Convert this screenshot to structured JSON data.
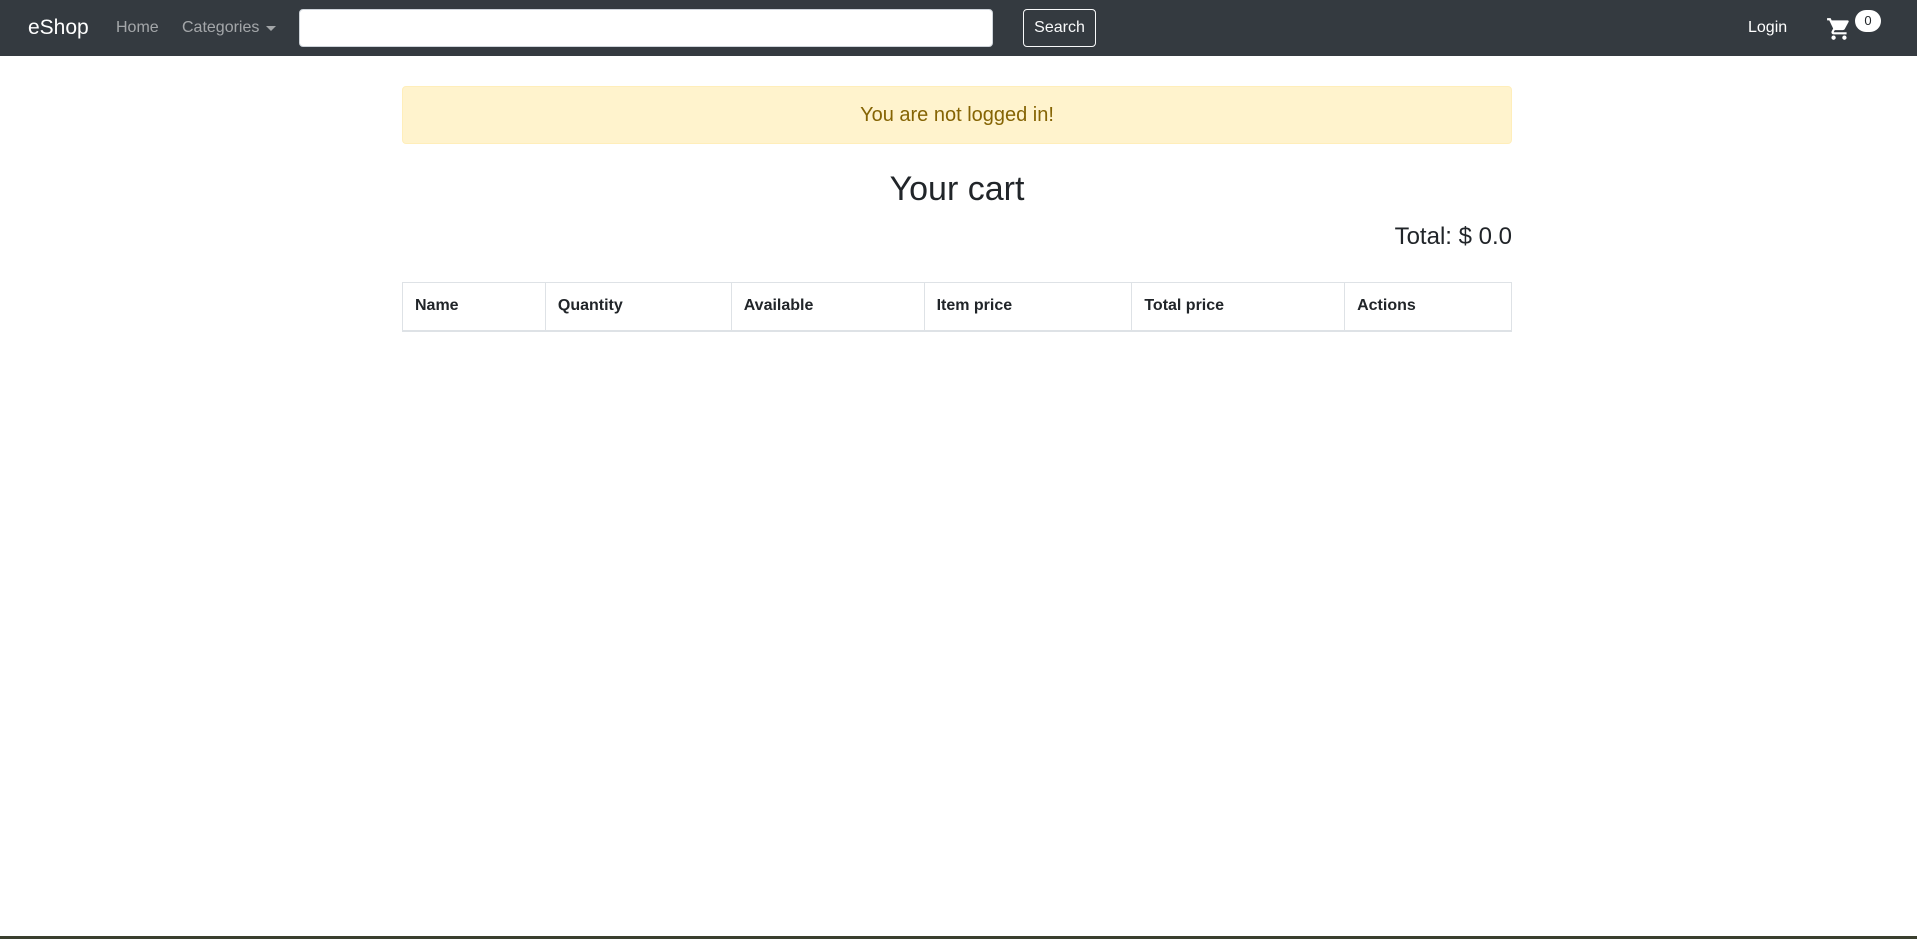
{
  "navbar": {
    "brand": "eShop",
    "home_label": "Home",
    "categories_label": "Categories",
    "search_value": "",
    "search_button_label": "Search",
    "login_label": "Login",
    "cart_count": "0",
    "cart_icon": "shopping-cart-icon",
    "dropdown_icon": "caret-down-icon"
  },
  "alert": {
    "message": "You are not logged in!"
  },
  "main": {
    "title": "Your cart",
    "total": "Total: $ 0.0"
  },
  "cart_table": {
    "headers": [
      "Name",
      "Quantity",
      "Available",
      "Item price",
      "Total price",
      "Actions"
    ],
    "rows": []
  },
  "colors": {
    "navbar_bg": "#343a40",
    "alert_bg": "#fff3cd",
    "alert_text": "#856404"
  }
}
